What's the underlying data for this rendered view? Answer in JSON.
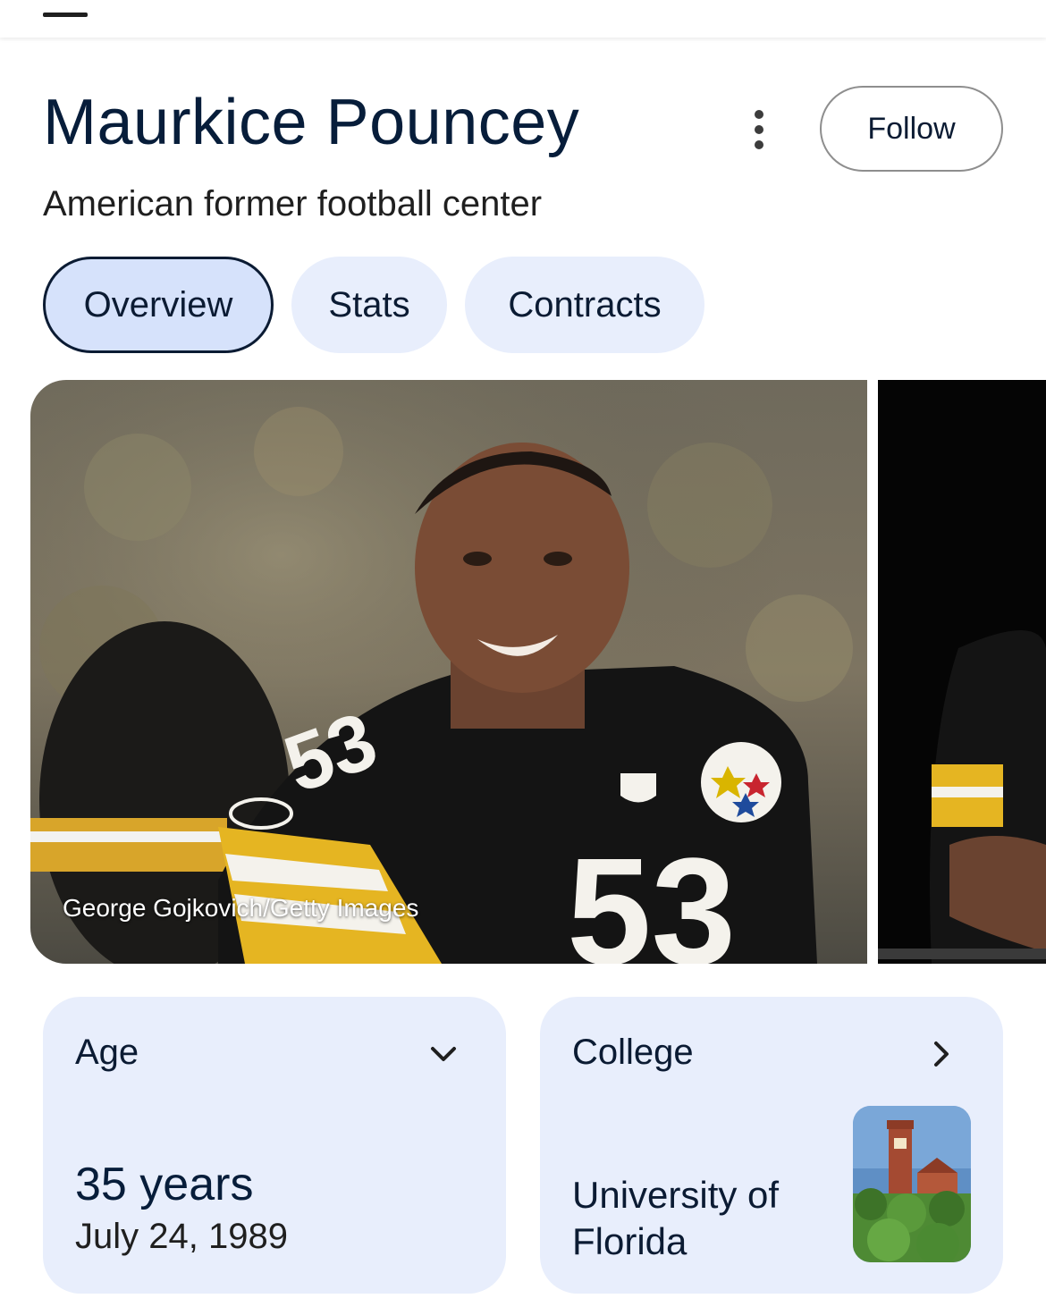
{
  "header": {
    "title": "Maurkice Pouncey",
    "subtitle": "American former football center",
    "follow_label": "Follow"
  },
  "tabs": [
    {
      "label": "Overview",
      "active": true
    },
    {
      "label": "Stats",
      "active": false
    },
    {
      "label": "Contracts",
      "active": false
    }
  ],
  "photos": {
    "main_credit": "George Gojkovich/Getty Images"
  },
  "cards": {
    "age": {
      "label": "Age",
      "value": "35 years",
      "date": "July 24, 1989",
      "icon": "chevron-down-icon"
    },
    "college": {
      "label": "College",
      "value": "University of Florida",
      "icon": "chevron-right-icon"
    }
  },
  "colors": {
    "card_bg": "#e8eefc",
    "active_tab_bg": "#d6e2fb",
    "text_dark": "#0b1b33"
  }
}
